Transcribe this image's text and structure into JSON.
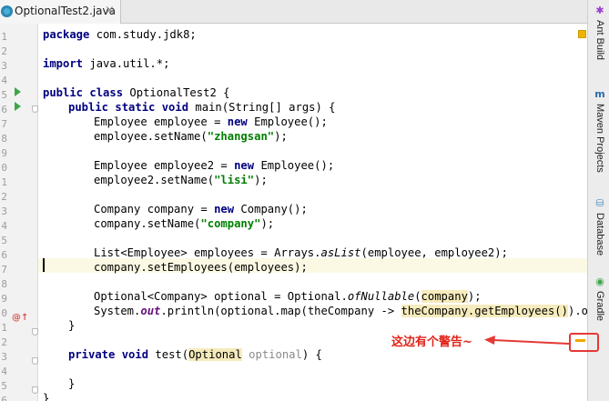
{
  "tab": {
    "title": "OptionalTest2.java",
    "close": "×"
  },
  "gutter": {
    "line_numbers": [
      "1",
      "2",
      "3",
      "4",
      "5",
      "6",
      "7",
      "8",
      "9",
      "0",
      "1",
      "2",
      "3",
      "4",
      "5",
      "6",
      "7",
      "8",
      "9",
      "0",
      "1",
      "2",
      "3",
      "4",
      "5",
      "6",
      "7"
    ]
  },
  "code": {
    "lines": {
      "l1": {
        "kw": "package",
        "rest": " com.study.jdk8;"
      },
      "l3": {
        "kw": "import",
        "rest": " java.util.*;"
      },
      "l5": {
        "kw": "public class",
        "rest": " OptionalTest2 {"
      },
      "l6": {
        "kw": "public static void",
        "rest": " main(String[] args) {"
      },
      "l7": {
        "a": "Employee employee = ",
        "kw": "new",
        "b": " Employee();"
      },
      "l8": {
        "a": "employee.setName(",
        "str": "\"zhangsan\"",
        "b": ");"
      },
      "l10": {
        "a": "Employee employee2 = ",
        "kw": "new",
        "b": " Employee();"
      },
      "l11": {
        "a": "employee2.setName(",
        "str": "\"lisi\"",
        "b": ");"
      },
      "l13": {
        "a": "Company company = ",
        "kw": "new",
        "b": " Company();"
      },
      "l14": {
        "a": "company.setName(",
        "str": "\"company\"",
        "b": ");"
      },
      "l16": {
        "a": "List<Employee> employees = Arrays.",
        "stat": "asList",
        "b": "(employee, employee2);"
      },
      "l17": {
        "a": "company.setEmployees(employees);"
      },
      "l19": {
        "a": "Optional<Company> optional = Optional.",
        "stat": "ofNullable",
        "b": "(",
        "hl": "company",
        "c": ");"
      },
      "l20": {
        "a": "System.",
        "fld": "out",
        "b": ".println(optional.map(theCompany -> ",
        "hl": "theCompany.getEmployees()",
        "c": ").orEls"
      },
      "l21": {
        "a": "}"
      },
      "l23": {
        "kw": "private void",
        "a": " test(",
        "hl": "Optional",
        "b": " ",
        "unused": "optional",
        "c": ") {"
      },
      "l25": {
        "a": "}"
      },
      "l26": {
        "a": "}"
      }
    }
  },
  "tool_windows": [
    {
      "label": "Ant Build",
      "icon": "ant-icon"
    },
    {
      "label": "Maven Projects",
      "icon": "maven-icon"
    },
    {
      "label": "Database",
      "icon": "database-icon"
    },
    {
      "label": "Gradle",
      "icon": "gradle-icon"
    }
  ],
  "annotation": {
    "text": "这边有个警告~"
  },
  "colors": {
    "keyword": "#000080",
    "string": "#008000",
    "highlight": "#f6ebbc",
    "warning": "#f0a800",
    "annotation_red": "#e53935"
  }
}
